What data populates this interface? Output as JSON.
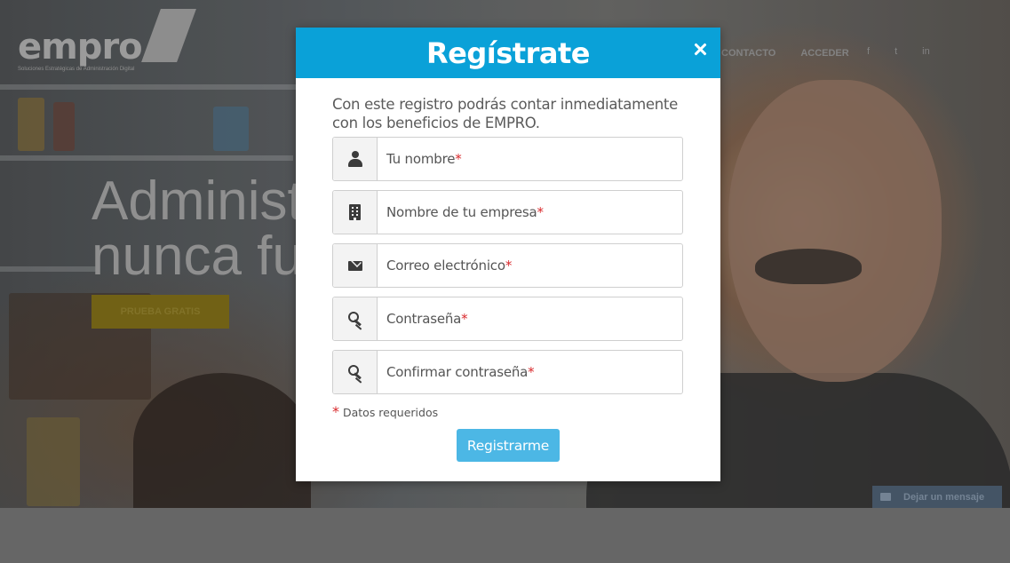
{
  "background": {
    "logo": {
      "text": "empro",
      "tagline": "Soluciones Estratégicas de Administración Digital"
    },
    "nav": {
      "items": [
        "CONTACTO",
        "ACCEDER"
      ]
    },
    "social": [
      "f",
      "t",
      "in"
    ],
    "hero": {
      "title": "Administ\nnunca fu",
      "cta_label": "PRUEBA GRATIS"
    },
    "chat": {
      "label": "Dejar un mensaje"
    }
  },
  "modal": {
    "title": "Regístrate",
    "intro": "Con este registro podrás contar inmediatamente con los beneficios de EMPRO.",
    "fields": [
      {
        "icon": "user-icon",
        "label": "Tu nombre",
        "required_mark": "*"
      },
      {
        "icon": "building-icon",
        "label": "Nombre de tu empresa",
        "required_mark": "*"
      },
      {
        "icon": "envelope-icon",
        "label": "Correo electrónico",
        "required_mark": "*"
      },
      {
        "icon": "key-icon",
        "label": "Contraseña",
        "required_mark": "*"
      },
      {
        "icon": "key-icon",
        "label": "Confirmar contraseña",
        "required_mark": "*"
      }
    ],
    "required_note": {
      "mark": "*",
      "text": "Datos requeridos"
    },
    "submit_label": "Registrarme",
    "colors": {
      "header": "#0aa1d8",
      "button": "#4cb7e5",
      "required": "#d9292c"
    }
  }
}
